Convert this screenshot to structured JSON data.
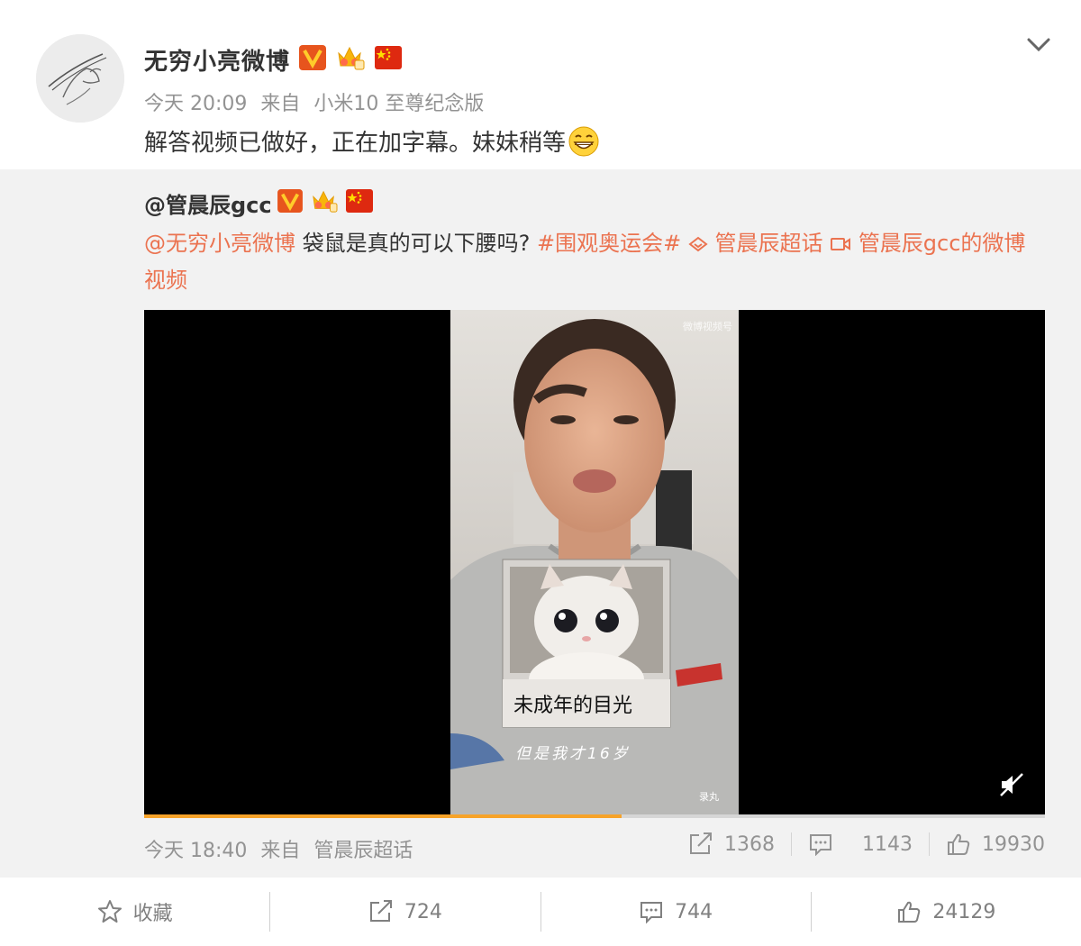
{
  "post": {
    "username": "无穷小亮微博",
    "time": "今天 20:09",
    "from_label": "来自",
    "device": "小米10 至尊纪念版",
    "text": "解答视频已做好，正在加字幕。妹妹稍等"
  },
  "repost": {
    "username": "@管晨辰gcc",
    "mention": "@无穷小亮微博",
    "body": "袋鼠是真的可以下腰吗?",
    "topic": "#围观奥运会#",
    "supertopic": "管晨辰超话",
    "video_link": "管晨辰gcc的微博视频",
    "time": "今天 18:40",
    "from_label": "来自",
    "source": "管晨辰超话",
    "reposts": "1368",
    "comments": "1143",
    "likes": "19930",
    "video": {
      "watermark": "微博视频号",
      "caption": "未成年的目光",
      "subtitle": "但是我才16岁",
      "corner_mark": "录丸",
      "progress": 0.53,
      "muted": true
    }
  },
  "actions": {
    "favorite_label": "收藏",
    "reposts": "724",
    "comments": "744",
    "likes": "24129"
  },
  "colors": {
    "link": "#eb7350",
    "progress": "#f7a329",
    "repost_bg": "#f2f2f2",
    "meta_text": "#939393"
  },
  "icons": [
    "chevron-down-icon",
    "verified-v-icon",
    "vip-crown-icon",
    "china-flag-icon",
    "grin-emoji-icon",
    "supertopic-icon",
    "video-link-icon",
    "mute-icon",
    "repost-icon",
    "comment-icon",
    "like-icon",
    "star-icon"
  ]
}
